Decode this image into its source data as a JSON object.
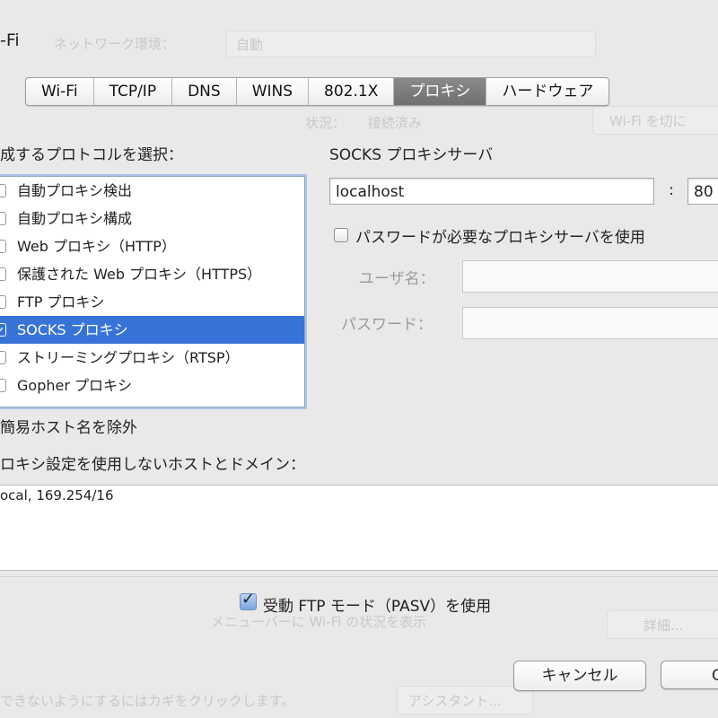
{
  "window": {
    "title_fragment": "-Fi"
  },
  "background": {
    "location_label": "ネットワーク環境：",
    "location_value": "自動",
    "status_label": "状況：",
    "status_value": "接続済み",
    "wifi_off_button": "Wi-Fi を切に",
    "menu_checkbox": "メニューバーに Wi-Fi の状況を表示",
    "advanced_button": "詳細...",
    "lock_note": "できないようにするにはカギをクリックします。",
    "assistant_button": "アシスタント..."
  },
  "tabs": [
    {
      "label": "Wi-Fi",
      "active": false
    },
    {
      "label": "TCP/IP",
      "active": false
    },
    {
      "label": "DNS",
      "active": false
    },
    {
      "label": "WINS",
      "active": false
    },
    {
      "label": "802.1X",
      "active": false
    },
    {
      "label": "プロキシ",
      "active": true
    },
    {
      "label": "ハードウェア",
      "active": false
    }
  ],
  "protocol_section": {
    "label": "成するプロトコルを選択：",
    "items": [
      {
        "label": "自動プロキシ検出",
        "checked": false,
        "selected": false
      },
      {
        "label": "自動プロキシ構成",
        "checked": false,
        "selected": false
      },
      {
        "label": "Web プロキシ（HTTP）",
        "checked": false,
        "selected": false
      },
      {
        "label": "保護された Web プロキシ（HTTPS）",
        "checked": false,
        "selected": false
      },
      {
        "label": "FTP プロキシ",
        "checked": false,
        "selected": false
      },
      {
        "label": "SOCKS プロキシ",
        "checked": true,
        "selected": true
      },
      {
        "label": "ストリーミングプロキシ（RTSP）",
        "checked": false,
        "selected": false
      },
      {
        "label": "Gopher プロキシ",
        "checked": false,
        "selected": false
      }
    ]
  },
  "exclude_simple_label": "簡易ホスト名を除外",
  "bypass": {
    "label": "ロキシ設定を使用しないホストとドメイン：",
    "value": "ocal, 169.254/16"
  },
  "socks": {
    "title": "SOCKS プロキシサーバ",
    "server": "localhost",
    "colon": ":",
    "port": "80",
    "password_checkbox_label": "パスワードが必要なプロキシサーバを使用",
    "password_checked": false,
    "username_label": "ユーザ名：",
    "username_value": "",
    "password_label": "パスワード：",
    "password_value": ""
  },
  "pasv": {
    "label": "受動 FTP モード（PASV）を使用",
    "checked": true
  },
  "buttons": {
    "cancel": "キャンセル",
    "ok": "O"
  },
  "colors": {
    "selection": "#3874d8",
    "active_tab": "#7a7a7a",
    "background": "#e9e9e9"
  }
}
